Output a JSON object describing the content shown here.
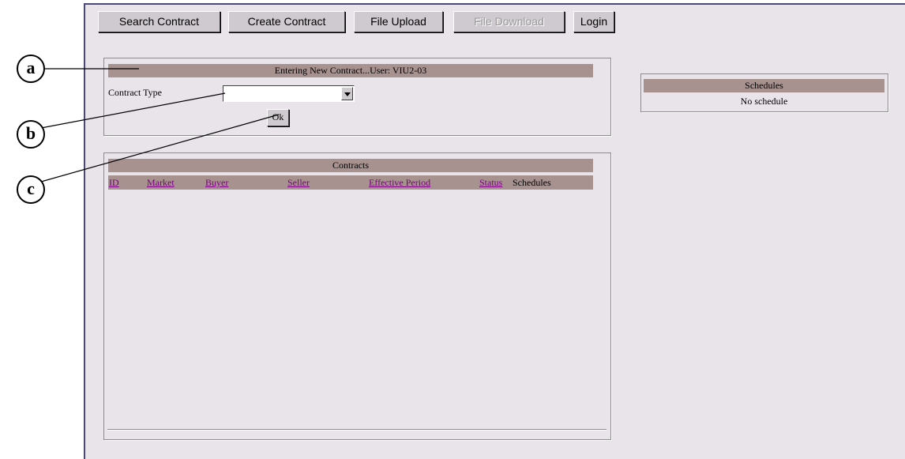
{
  "toolbar": {
    "search_contract": "Search Contract",
    "create_contract": "Create Contract",
    "file_upload": "File Upload",
    "file_download": "File Download",
    "login": "Login"
  },
  "entry": {
    "header": "Entering New Contract...User: VIU2-03",
    "contract_type_label": "Contract Type",
    "contract_type_value": "",
    "ok_label": "Ok"
  },
  "schedules": {
    "header": "Schedules",
    "empty_text": "No schedule"
  },
  "contracts": {
    "header": "Contracts",
    "columns": [
      "ID",
      "Market",
      "Buyer",
      "Seller",
      "Effective Period",
      "Status",
      "Schedules"
    ]
  },
  "callouts": [
    "a",
    "b",
    "c"
  ]
}
